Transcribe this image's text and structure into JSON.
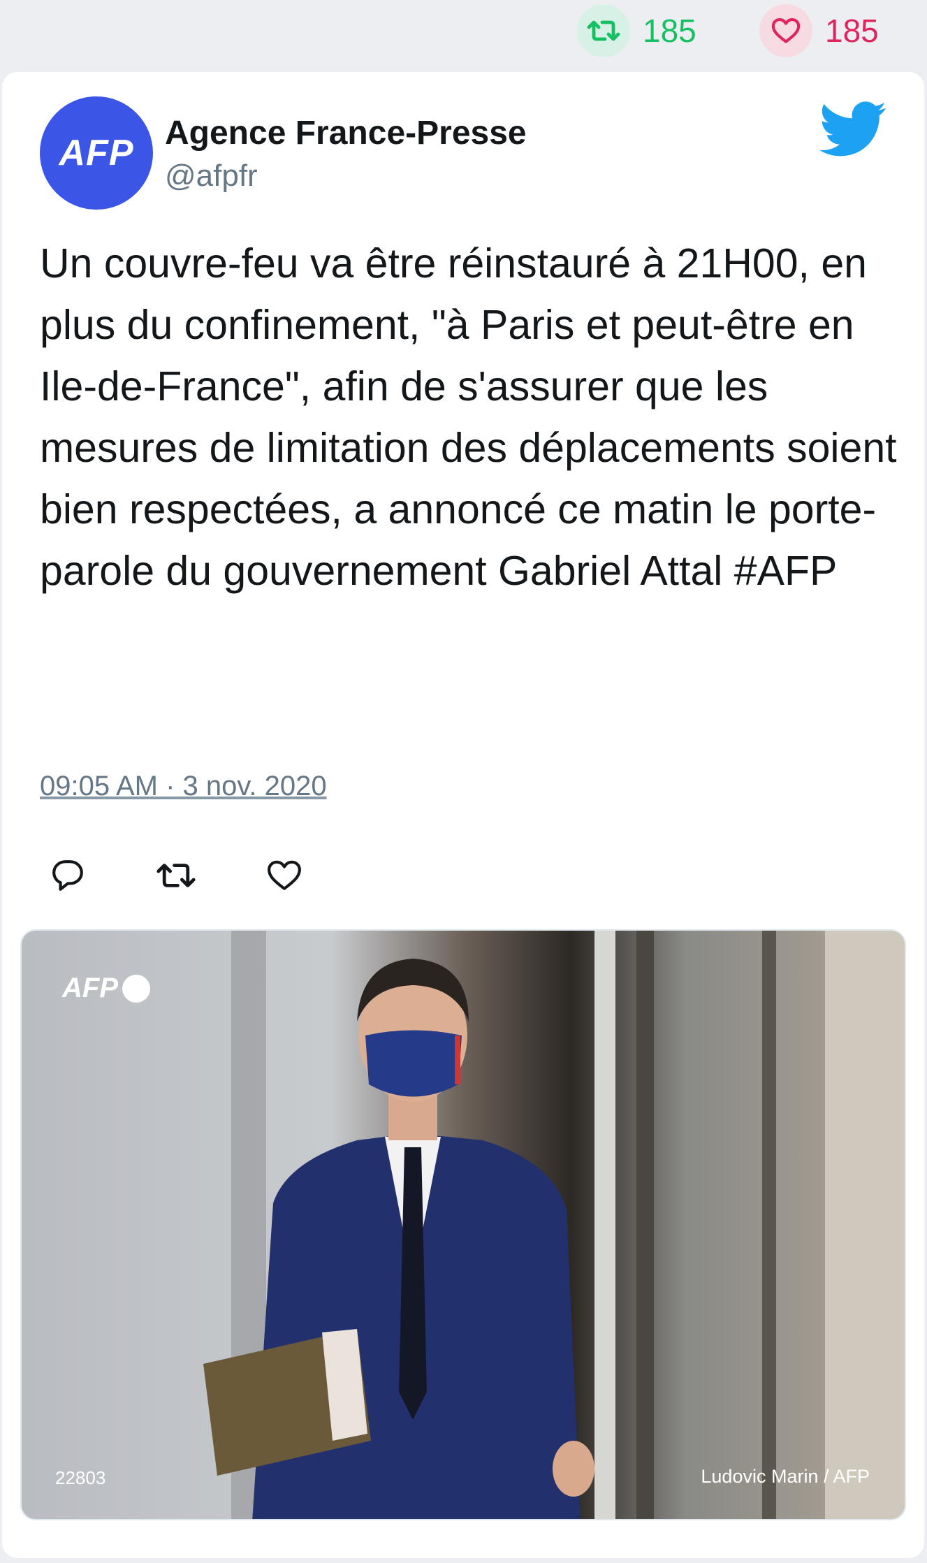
{
  "stats": {
    "retweets": "185",
    "likes": "185"
  },
  "tweet": {
    "avatar_text": "AFP",
    "author_name": "Agence France-Presse",
    "author_handle": "@afpfr",
    "text": "Un couvre-feu va être réinstauré à 21H00, en plus du confinement, \"à Paris et peut-être en Ile-de-France\", afin de s'assurer que les mesures de limitation des déplacements soient bien respectées, a annoncé ce matin le porte-parole du gouvernement Gabriel Attal #AFP",
    "timestamp": "09:05 AM · 3 nov. 2020"
  },
  "photo": {
    "logo_text": "AFP",
    "photo_id": "22803",
    "credit": "Ludovic Marin / AFP"
  },
  "icons": [
    "retweet-icon",
    "heart-icon",
    "twitter-bird-icon",
    "reply-icon"
  ],
  "colors": {
    "retweet": "#17bf63",
    "like": "#e0245e",
    "twitter_blue": "#1da1f2",
    "avatar": "#3b55e6"
  }
}
